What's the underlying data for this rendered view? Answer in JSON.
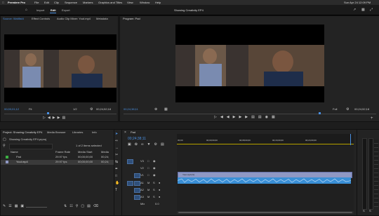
{
  "mac_menu": {
    "app": "Premiere Pro",
    "items": [
      "File",
      "Edit",
      "Clip",
      "Sequence",
      "Markers",
      "Graphics and Titles",
      "View",
      "Window",
      "Help"
    ],
    "clock": "Sun Apr 24  12:09 PM"
  },
  "app_bar": {
    "tabs": [
      "Import",
      "Edit",
      "Export"
    ],
    "title": "Showing Creativity EP4"
  },
  "source_panel": {
    "tabs": [
      "Source: Waitlist4",
      "Effect Controls",
      "Audio Clip Mixer: Yout.mp4",
      "Metadata"
    ],
    "timecode": "00;00;01;12",
    "fit": "Fit",
    "fraction": "1/2",
    "duration": "00;24;52;18"
  },
  "program_panel": {
    "title": "Program: Pad",
    "timecode": "00;24;38;11",
    "fit": "Full",
    "fraction": "1/2",
    "duration": "00;24;52;18"
  },
  "project_panel": {
    "tabs": [
      "Project: Showing Creativity EP4",
      "Media Browser",
      "Libraries",
      "Info"
    ],
    "path": "Showing Creativity EP4.prproj",
    "selection": "1 of 2 items selected",
    "headers": [
      "Name",
      "Frame Rate",
      "Media Start",
      "Media"
    ],
    "rows": [
      {
        "name": "Pad",
        "rate": "29.97 fps",
        "start": "00;00;00;00",
        "media": "00;24;"
      },
      {
        "name": "Yout.mp4",
        "rate": "29.97 fps",
        "start": "00;00;00;00",
        "media": "00;24;"
      }
    ]
  },
  "timeline": {
    "tab": "Pad",
    "timecode": "00;24;38;11",
    "ruler": [
      "00;00",
      "00;00;00;00",
      "00;08;00;00",
      "00;16;00;00",
      "00;24;00;00"
    ],
    "tracks": [
      "V3",
      "V2",
      "V1",
      "A1",
      "A2",
      "A3"
    ],
    "mix": "Mix",
    "mix_value": "0.0",
    "clip_label": "Yout.mp4 [V]"
  },
  "colors": {
    "accent": "#4a90e2",
    "video_clip": "#8f98c4",
    "audio_clip": "#3a8fd6",
    "playhead": "#4a90e2"
  }
}
